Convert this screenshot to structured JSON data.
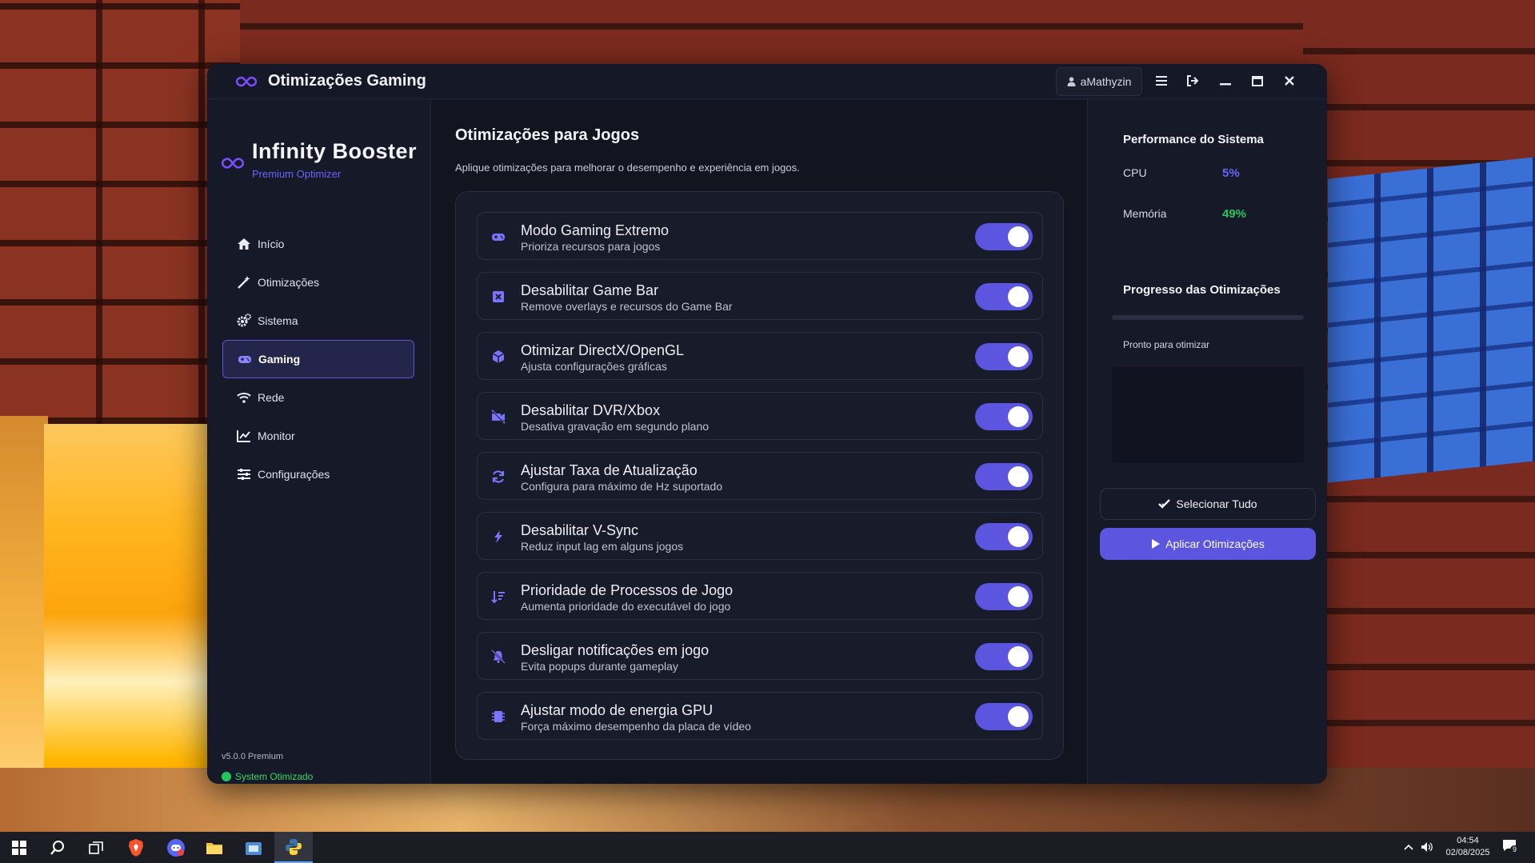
{
  "window": {
    "title": "Otimizações Gaming",
    "user": "aMathyzin"
  },
  "brand": {
    "name": "Infinity Booster",
    "subtitle": "Premium Optimizer"
  },
  "sidebar": {
    "items": [
      {
        "label": "Início",
        "icon": "home-icon"
      },
      {
        "label": "Otimizações",
        "icon": "magic-wand-icon"
      },
      {
        "label": "Sistema",
        "icon": "gears-icon"
      },
      {
        "label": "Gaming",
        "icon": "gamepad-icon",
        "active": true
      },
      {
        "label": "Rede",
        "icon": "wifi-icon"
      },
      {
        "label": "Monitor",
        "icon": "chart-line-icon"
      },
      {
        "label": "Configurações",
        "icon": "sliders-icon"
      }
    ],
    "version": "v5.0.0 Premium",
    "status": "System Otimizado"
  },
  "main": {
    "title": "Otimizações para Jogos",
    "subtitle": "Aplique otimizações para melhorar o desempenho e experiência em jogos.",
    "options": [
      {
        "name": "Modo Gaming Extremo",
        "desc": "Prioriza recursos para jogos",
        "icon": "gamepad-icon",
        "enabled": true
      },
      {
        "name": "Desabilitar Game Bar",
        "desc": "Remove overlays e recursos do Game Bar",
        "icon": "square-x-icon",
        "enabled": true
      },
      {
        "name": "Otimizar DirectX/OpenGL",
        "desc": "Ajusta configurações gráficas",
        "icon": "cube-icon",
        "enabled": true
      },
      {
        "name": "Desabilitar DVR/Xbox",
        "desc": "Desativa gravação em segundo plano",
        "icon": "video-slash-icon",
        "enabled": true
      },
      {
        "name": "Ajustar Taxa de Atualização",
        "desc": "Configura para máximo de Hz suportado",
        "icon": "sync-icon",
        "enabled": true
      },
      {
        "name": "Desabilitar V-Sync",
        "desc": "Reduz input lag em alguns jogos",
        "icon": "bolt-icon",
        "enabled": true
      },
      {
        "name": "Prioridade de Processos de Jogo",
        "desc": "Aumenta prioridade do executável do jogo",
        "icon": "sort-amount-icon",
        "enabled": true
      },
      {
        "name": "Desligar notificações em jogo",
        "desc": "Evita popups durante gameplay",
        "icon": "bell-slash-icon",
        "enabled": true
      },
      {
        "name": "Ajustar modo de energia GPU",
        "desc": "Força máximo desempenho da placa de vídeo",
        "icon": "microchip-icon",
        "enabled": true
      }
    ]
  },
  "performance": {
    "title": "Performance do Sistema",
    "cpu_label": "CPU",
    "cpu_value": "5%",
    "mem_label": "Memória",
    "mem_value": "49%",
    "colors": {
      "cpu": "#6c63ff",
      "mem": "#22c55e"
    }
  },
  "progress": {
    "title": "Progresso das Otimizações",
    "value": 0,
    "status": "Pronto para otimizar"
  },
  "actions": {
    "select_all": "Selecionar Tudo",
    "apply": "Aplicar Otimizações"
  },
  "taskbar": {
    "time": "04:54",
    "date": "02/08/2025",
    "notifications": "9"
  },
  "colors": {
    "accent": "#5b55e0",
    "background": "#12141f",
    "panel": "#181b29"
  }
}
